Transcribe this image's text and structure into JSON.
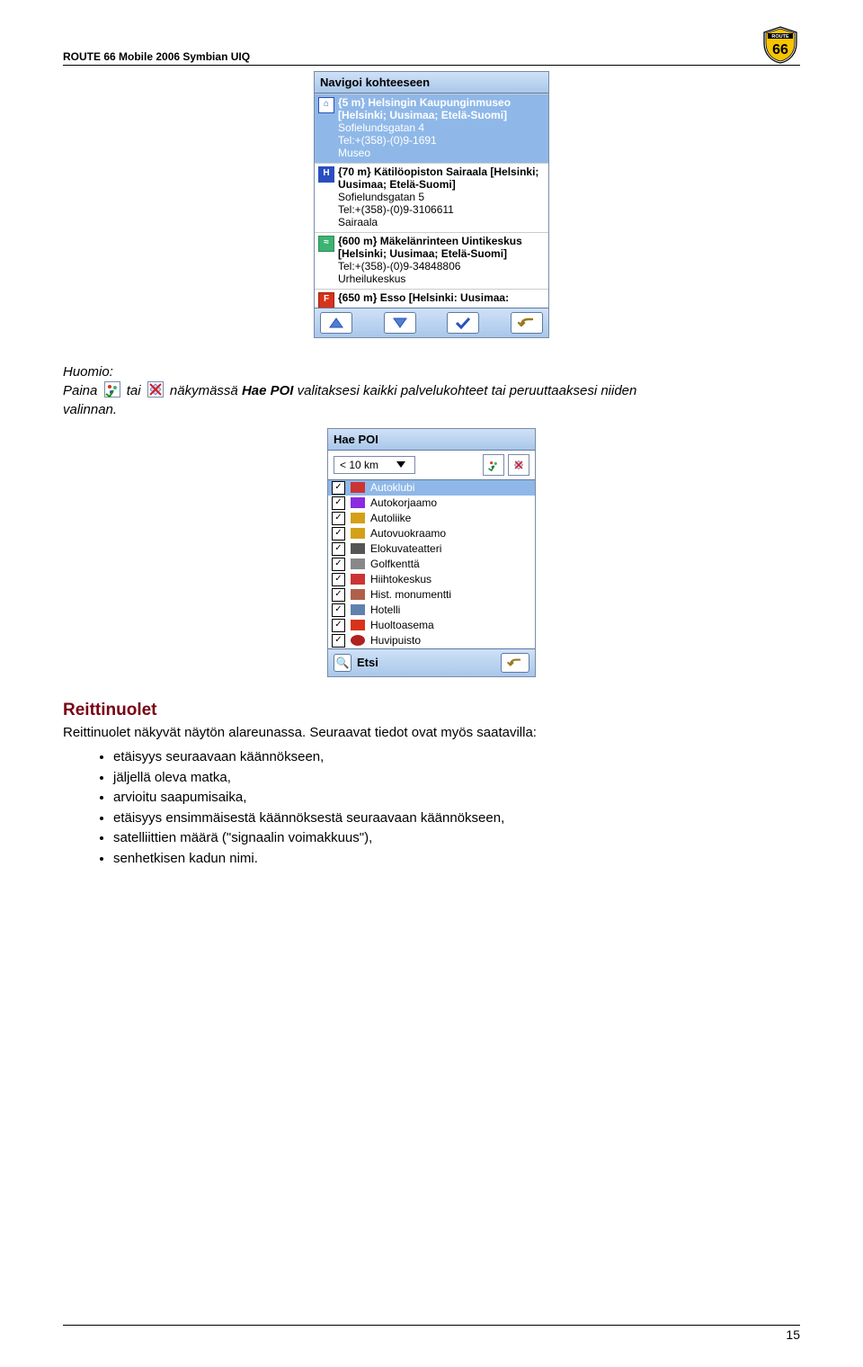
{
  "header": {
    "title": "ROUTE 66 Mobile 2006 Symbian UIQ"
  },
  "screenshot1": {
    "title": "Navigoi kohteeseen",
    "items": [
      {
        "icon": "home",
        "iconColor": "#2a4fbf",
        "iconBg": "#ffffff",
        "iconGlyph": "⌂",
        "selected": true,
        "title": "{5 m} Helsingin Kaupunginmuseo [Helsinki; Uusimaa; Etelä-Suomi]",
        "addr": "Sofielundsgatan 4",
        "tel": "Tel:+(358)-(0)9-1691",
        "type": "Museo"
      },
      {
        "icon": "hospital",
        "iconColor": "#ffffff",
        "iconBg": "#2a4fbf",
        "iconGlyph": "H",
        "selected": false,
        "title": "{70 m} Kätilöopiston Sairaala [Helsinki; Uusimaa; Etelä-Suomi]",
        "addr": "Sofielundsgatan 5",
        "tel": "Tel:+(358)-(0)9-3106611",
        "type": "Sairaala"
      },
      {
        "icon": "pool",
        "iconColor": "#ffffff",
        "iconBg": "#3cb371",
        "iconGlyph": "≈",
        "selected": false,
        "title": "{600 m} Mäkelänrinteen Uintikeskus [Helsinki; Uusimaa; Etelä-Suomi]",
        "addr": "",
        "tel": "Tel:+(358)-(0)9-34848806",
        "type": "Urheilukeskus"
      }
    ],
    "cutoff": {
      "iconBg": "#d8321a",
      "iconGlyph": "F",
      "title": "{650 m} Esso [Helsinki: Uusimaa:"
    }
  },
  "para1": {
    "pre": "Huomio:",
    "line_a": "Paina",
    "line_b": "tai",
    "line_c": "näkymässä",
    "line_d": "Hae POI",
    "line_e": "valitaksesi kaikki palvelukohteet tai peruuttaaksesi niiden",
    "line_f": "valinnan."
  },
  "screenshot2": {
    "title": "Hae POI",
    "distance": "< 10 km",
    "categories": [
      {
        "label": "Autoklubi",
        "selected": true,
        "iconColor": "#cc3333"
      },
      {
        "label": "Autokorjaamo",
        "iconColor": "#8a2be2"
      },
      {
        "label": "Autoliike",
        "iconColor": "#d4a017"
      },
      {
        "label": "Autovuokraamo",
        "iconColor": "#d4a017"
      },
      {
        "label": "Elokuvateatteri",
        "iconColor": "#555555"
      },
      {
        "label": "Golfkenttä",
        "iconColor": "#666666"
      },
      {
        "label": "Hiihtokeskus",
        "iconColor": "#cc3333"
      },
      {
        "label": "Hist. monumentti",
        "iconColor": "#b0604a"
      },
      {
        "label": "Hotelli",
        "iconColor": "#6080b0"
      },
      {
        "label": "Huoltoasema",
        "iconColor": "#d8321a"
      },
      {
        "label": "Huvipuisto",
        "iconColor": "#b02020"
      }
    ],
    "search_label": "Etsi"
  },
  "section_arrows": {
    "heading": "Reittinuolet",
    "intro": "Reittinuolet näkyvät näytön alareunassa. Seuraavat tiedot ovat myös saatavilla:",
    "bullets": [
      "etäisyys seuraavaan käännökseen,",
      "jäljellä oleva matka,",
      "arvioitu saapumisaika,",
      "etäisyys ensimmäisestä käännöksestä seuraavaan käännökseen,",
      "satelliittien määrä (\"signaalin voimakkuus\"),",
      "senhetkisen kadun nimi."
    ]
  },
  "page_number": "15"
}
